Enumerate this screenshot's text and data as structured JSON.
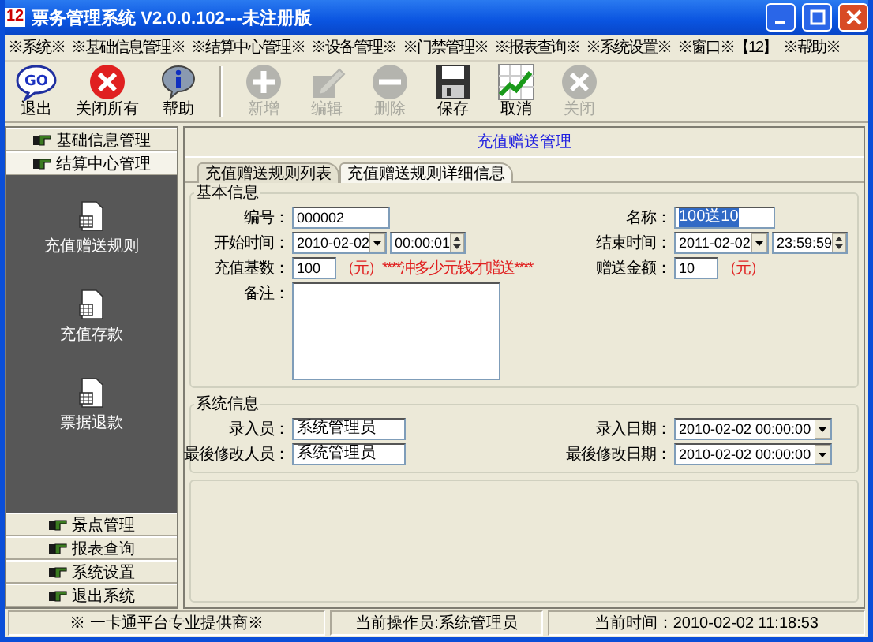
{
  "window": {
    "title": "票务管理系统 V2.0.0.102---未注册版",
    "logo": "12"
  },
  "menu": [
    "※系统※",
    "※基础信息管理※",
    "※结算中心管理※",
    "※设备管理※",
    "※门禁管理※",
    "※报表查询※",
    "※系统设置※",
    "※窗口※【12】",
    "※帮助※"
  ],
  "toolbar": [
    [
      {
        "label": "退出",
        "kind": "go",
        "icon_text": "GO",
        "disabled": false
      },
      {
        "label": "关闭所有",
        "kind": "close",
        "disabled": false
      },
      {
        "label": "帮助",
        "kind": "info",
        "disabled": false
      }
    ],
    [
      {
        "label": "新增",
        "kind": "add",
        "disabled": true
      },
      {
        "label": "编辑",
        "kind": "edit",
        "disabled": true
      },
      {
        "label": "删除",
        "kind": "remove",
        "disabled": true
      },
      {
        "label": "保存",
        "kind": "save",
        "disabled": false
      },
      {
        "label": "取消",
        "kind": "chart",
        "disabled": false
      },
      {
        "label": "关闭",
        "kind": "close",
        "disabled": true
      }
    ]
  ],
  "sidebar": [
    {
      "label": "基础信息管理",
      "expanded": false
    },
    {
      "label": "结算中心管理",
      "expanded": true,
      "items": [
        {
          "label": "充值赠送规则"
        },
        {
          "label": "充值存款"
        },
        {
          "label": "票据退款"
        }
      ]
    },
    {
      "label": "景点管理",
      "expanded": false
    },
    {
      "label": "报表查询",
      "expanded": false
    },
    {
      "label": "系统设置",
      "expanded": false
    },
    {
      "label": "退出系统",
      "expanded": false
    }
  ],
  "main": {
    "title": "充值赠送管理",
    "tabs": [
      {
        "label": "充值赠送规则列表",
        "selected": false
      },
      {
        "label": "充值赠送规则详细信息",
        "selected": true
      }
    ],
    "basic_info": {
      "title": "基本信息",
      "code": {
        "label": "编号：",
        "value": "000002"
      },
      "name": {
        "label": "名称：",
        "value": "100送10",
        "selected": true
      },
      "start": {
        "label": "开始时间：",
        "date": "2010-02-02",
        "time": "00:00:01"
      },
      "end": {
        "label": "结束时间：",
        "date": "2011-02-02",
        "time": "23:59:59"
      },
      "base": {
        "label": "充值基数：",
        "value": "100",
        "note": "（元）****冲多少元钱才赠送****"
      },
      "gift": {
        "label": "赠送金额：",
        "value": "10",
        "note": "（元）"
      },
      "remark": {
        "label": "备注："
      }
    },
    "system_info": {
      "title": "系统信息",
      "creator": {
        "label": "录入员：",
        "value": "系统管理员"
      },
      "modifier": {
        "label": "最後修改人员：",
        "value": "系统管理员"
      },
      "created": {
        "label": "录入日期：",
        "value": "2010-02-02 00:00:00"
      },
      "modified": {
        "label": "最後修改日期：",
        "value": "2010-02-02 00:00:00"
      }
    }
  },
  "status_bar": [
    "※ 一卡通平台专业提供商※",
    "当前操作员:系统管理员",
    "当前时间：2010-02-02 11:18:53"
  ]
}
